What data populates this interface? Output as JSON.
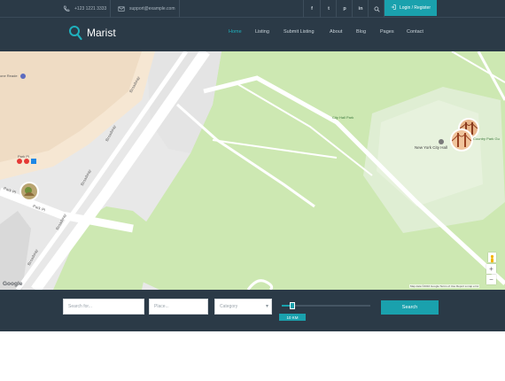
{
  "topbar": {
    "phone": "+123 1221 3333",
    "email": "support@example.com",
    "social": [
      "f",
      "t",
      "p",
      "in"
    ],
    "login_label": "Login / Register"
  },
  "header": {
    "brand": "Marist",
    "nav": [
      "Home",
      "Listing",
      "Submit Listing",
      "About",
      "Blog",
      "Pages",
      "Contact"
    ],
    "active_nav": "Home"
  },
  "map": {
    "labels": {
      "broadway": "Broadway",
      "park_pl": "Park Pl",
      "city_hall_park": "City Hall Park",
      "nyc_hall": "New York City Hall",
      "country_park": "Country Park Gu",
      "park_pl_station": "Park Pl",
      "top_left_poi": "one Reade"
    },
    "brand": "Google",
    "attribution": "Map data ©2016 Google   Terms of Use   Report a map error",
    "zoom_in": "+",
    "zoom_out": "−"
  },
  "search": {
    "search_placeholder": "Search for...",
    "place_placeholder": "Place...",
    "category_placeholder": "Category",
    "radius_value": "10 KM",
    "search_button": "Search"
  },
  "colors": {
    "accent": "#1aa1ad",
    "dark": "#2b3a47",
    "park": "#cde8b2"
  }
}
